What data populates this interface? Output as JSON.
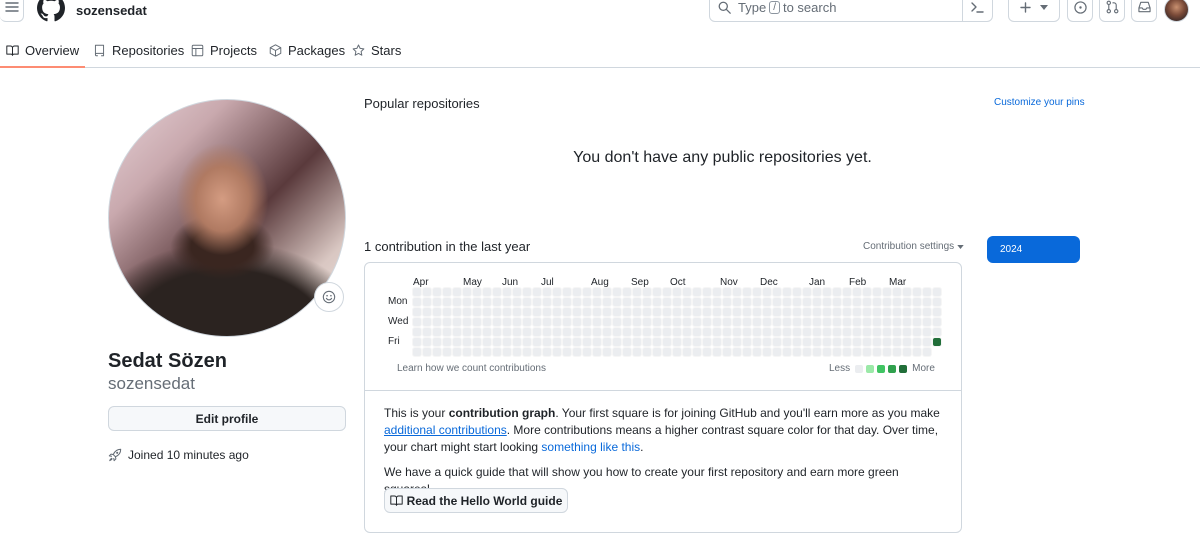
{
  "header": {
    "username": "sozensedat",
    "search": {
      "pre": "Type",
      "key": "/",
      "post": "to search"
    },
    "icons": [
      "hamburger-icon",
      "github-logo-icon",
      "search-icon",
      "command-palette-icon",
      "plus-icon",
      "triangle-down-icon",
      "issue-icon",
      "pull-request-icon",
      "inbox-icon"
    ]
  },
  "tabs": [
    {
      "label": "Overview",
      "icon": "book-icon",
      "active": true
    },
    {
      "label": "Repositories",
      "icon": "repo-icon"
    },
    {
      "label": "Projects",
      "icon": "table-icon"
    },
    {
      "label": "Packages",
      "icon": "package-icon"
    },
    {
      "label": "Stars",
      "icon": "star-icon"
    }
  ],
  "profile": {
    "full_name": "Sedat Sözen",
    "login": "sozensedat",
    "edit_label": "Edit profile",
    "joined": "Joined 10 minutes ago"
  },
  "popular": {
    "title": "Popular repositories",
    "customize": "Customize your pins",
    "empty": "You don't have any public repositories yet."
  },
  "contributions": {
    "title": "1 contribution in the last year",
    "settings": "Contribution settings",
    "year": "2024",
    "months": [
      "Apr",
      "May",
      "Jun",
      "Jul",
      "Aug",
      "Sep",
      "Oct",
      "Nov",
      "Dec",
      "Jan",
      "Feb",
      "Mar"
    ],
    "days": [
      "Mon",
      "Wed",
      "Fri"
    ],
    "weeks": 53,
    "total": 1,
    "learn": "Learn how we count contributions",
    "legend_less": "Less",
    "legend_more": "More",
    "colors": [
      "#ebedf0",
      "#9be9a8",
      "#40c463",
      "#30a14e",
      "#216e39"
    ]
  },
  "info": {
    "p1_a": "This is your ",
    "p1_b": "contribution graph",
    "p1_c": ". Your first square is for joining GitHub and you'll earn more as you make ",
    "p1_link1": "additional contributions",
    "p1_d": ". More contributions means a higher contrast square color for that day. Over time, your chart might start looking ",
    "p1_link2": "something like this",
    "p1_e": ".",
    "p2": "We have a quick guide that will show you how to create your first repository and earn more green squares!",
    "guide_btn": "Read the Hello World guide"
  }
}
